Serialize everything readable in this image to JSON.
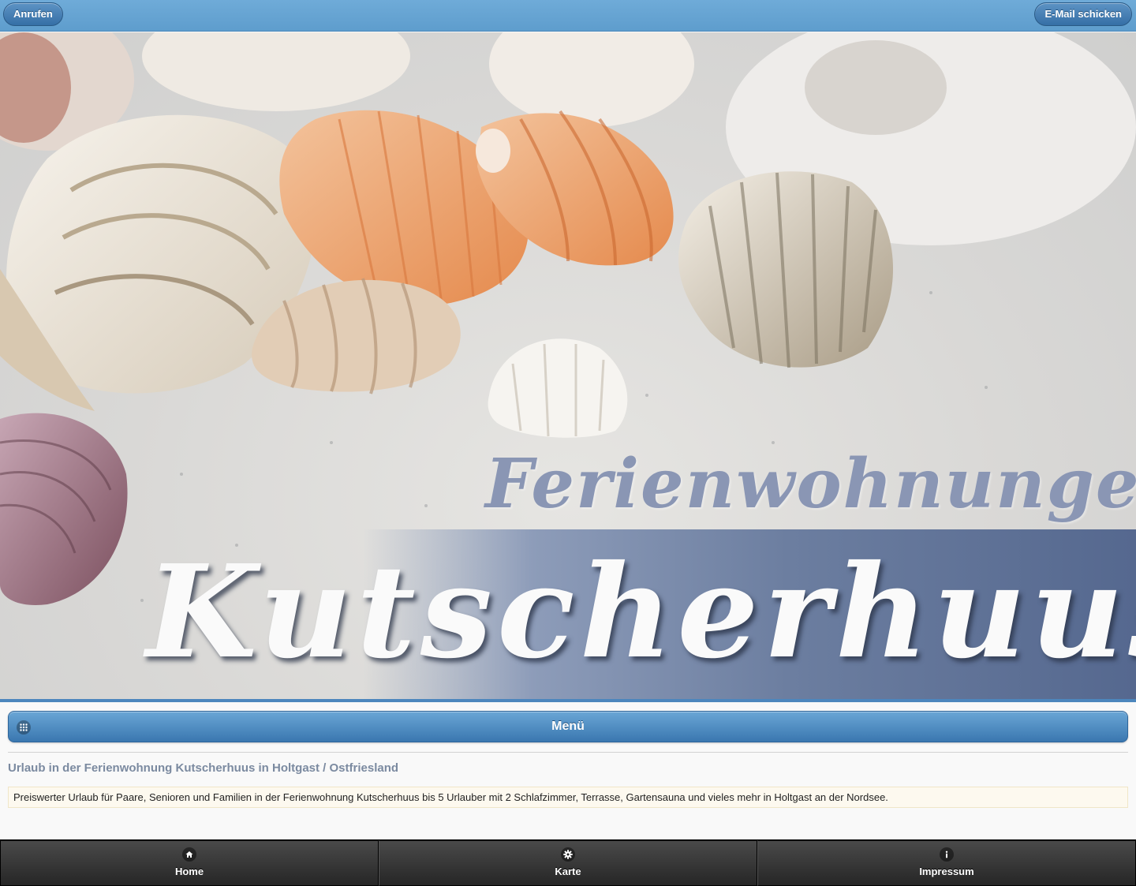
{
  "header": {
    "call_label": "Anrufen",
    "email_label": "E-Mail schicken"
  },
  "hero": {
    "subtitle": "Ferienwohnungen",
    "title": "Kutscherhuus"
  },
  "menu": {
    "label": "Menü",
    "icon": "grid-icon"
  },
  "content": {
    "headline": "Urlaub in der Ferienwohnung Kutscherhuus in Holtgast / Ostfriesland",
    "description": "Preiswerter Urlaub für Paare, Senioren und Familien in der Ferienwohnung Kutscherhuus bis 5 Urlauber mit 2 Schlafzimmer, Terrasse, Gartensauna und vieles mehr in Holtgast an der Nordsee."
  },
  "footer": {
    "tabs": [
      {
        "label": "Home",
        "icon": "home-icon"
      },
      {
        "label": "Karte",
        "icon": "gear-icon"
      },
      {
        "label": "Impressum",
        "icon": "info-icon"
      }
    ]
  },
  "colors": {
    "header_blue": "#6fabd8",
    "button_blue": "#356fa6",
    "footer_dark": "#262626",
    "headline_gray": "#7b8aa0"
  }
}
